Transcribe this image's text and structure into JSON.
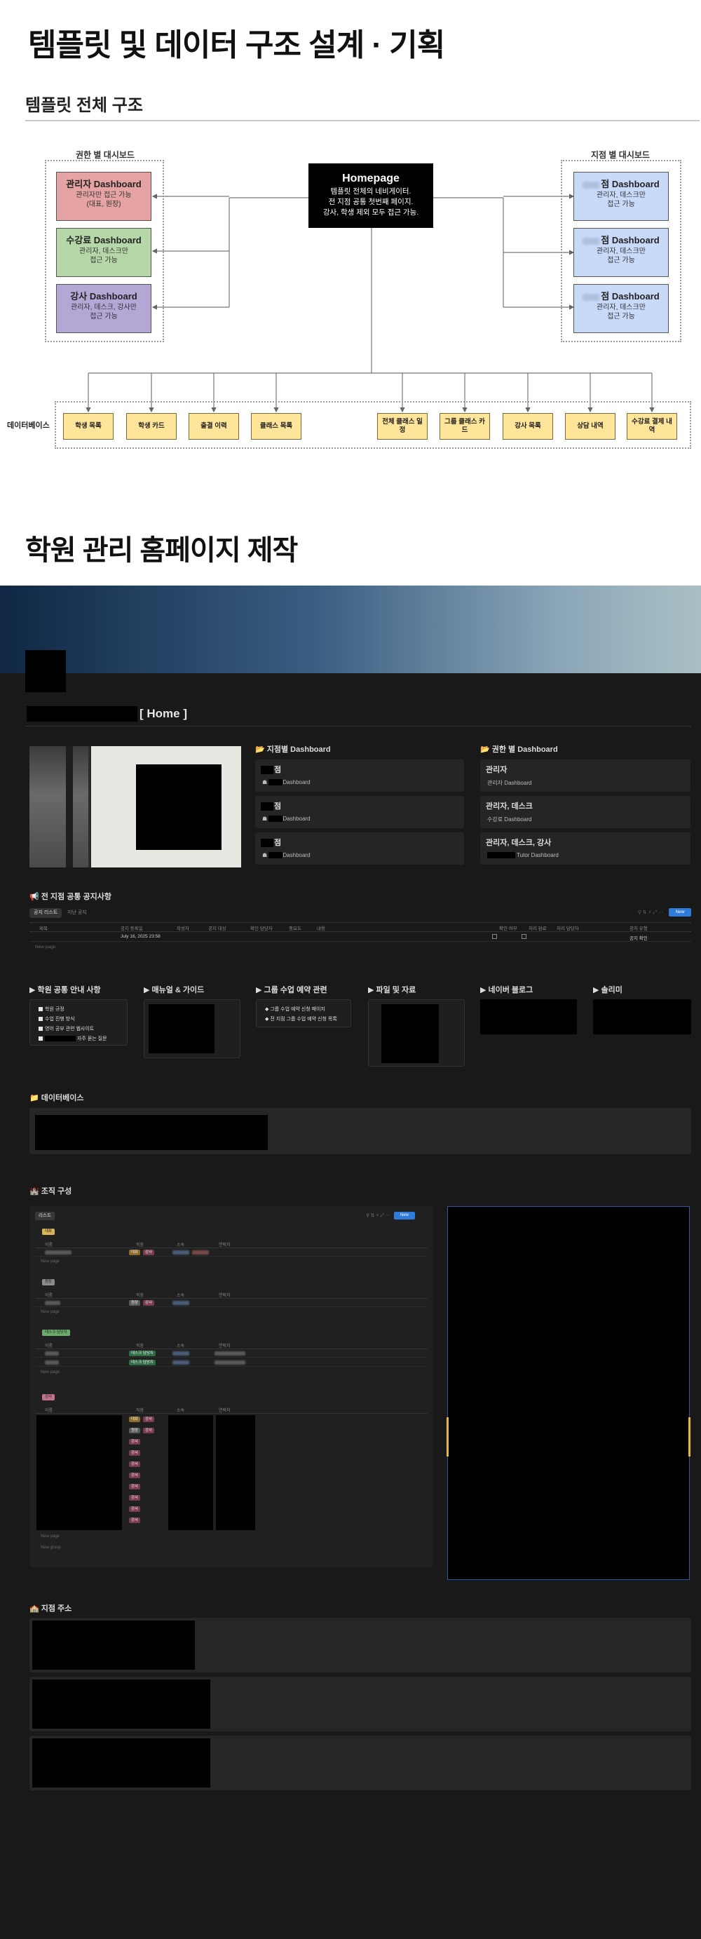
{
  "main_title": "템플릿 및 데이터 구조 설계 · 기획",
  "structure_section_title": "템플릿 전체 구조",
  "diagram": {
    "left_group_label": "권한 별 대시보드",
    "right_group_label": "지점 별 대시보드",
    "homepage": {
      "title": "Homepage",
      "line1": "템플릿 전체의 네비게이터.",
      "line2": "전 지점 공통 첫번째 페이지.",
      "line3": "강사, 학생 제외 모두 접근 가능."
    },
    "role_dashboards": [
      {
        "title": "관리자 Dashboard",
        "line1": "관리자만 접근 가능",
        "line2": "(대표, 원장)"
      },
      {
        "title": "수강료 Dashboard",
        "line1": "관리자, 데스크만",
        "line2": "접근 가능"
      },
      {
        "title": "강사 Dashboard",
        "line1": "관리자, 데스크, 강사만",
        "line2": "접근 가능"
      }
    ],
    "branch_dashboards": [
      {
        "title": "점 Dashboard",
        "line1": "관리자, 데스크만",
        "line2": "접근 가능"
      },
      {
        "title": "점 Dashboard",
        "line1": "관리자, 데스크만",
        "line2": "접근 가능"
      },
      {
        "title": "점 Dashboard",
        "line1": "관리자, 데스크만",
        "line2": "접근 가능"
      }
    ],
    "database_label": "데이터베이스",
    "databases": [
      "학생 목록",
      "학생 카드",
      "출결 이력",
      "클래스 목록",
      "전체 클래스 일정",
      "그룹 클래스 카드",
      "강사 목록",
      "상담 내역",
      "수강료 결제 내역"
    ]
  },
  "homepage_section_title": "학원 관리 홈페이지 제작",
  "notion": {
    "page_title_suffix": "[ Home ]",
    "branch_col_title": "📂 지점별 Dashboard",
    "role_col_title": "📂 권한 별 Dashboard",
    "branch_cards": [
      {
        "name": "점",
        "sub": "Dashboard"
      },
      {
        "name": "점",
        "sub": "Dashboard"
      },
      {
        "name": "점",
        "sub": "Dashboard"
      }
    ],
    "role_cards": [
      {
        "name": "관리자",
        "sub": "관리자 Dashboard"
      },
      {
        "name": "관리자, 데스크",
        "sub": "수강료 Dashboard"
      },
      {
        "name": "관리자, 데스크, 강사",
        "sub": "Tutor Dashboard"
      }
    ],
    "notice_title": "📢 전 지점 공통 공지사항",
    "notice_tab": "공지 리스트",
    "notice_tab2": "지난 공지",
    "notice_new": "New",
    "notice_columns": [
      "제목",
      "공지 등록일",
      "작성자",
      "공지 대상",
      "확인 담당자",
      "중요도",
      "내용",
      "확인 여부",
      "처리 완료",
      "처리 담당자",
      "공지 유형"
    ],
    "notice_row": {
      "date": "July 16, 2025 23:58",
      "type": "공지 확인"
    },
    "new_page": "New page",
    "toggles": [
      {
        "title": "학원 공통 안내 사항",
        "items": [
          "학원 규정",
          "수업 진행 방식",
          "영어 공부 관련 웹사이트",
          "자주 묻는 질문"
        ]
      },
      {
        "title": "매뉴얼 & 가이드",
        "items": []
      },
      {
        "title": "그룹 수업 예약 관련",
        "items": [
          "그룹 수업 예약 신청 페이지",
          "전 지점 그룹 수업 예약 신청 목록"
        ]
      },
      {
        "title": "파일 및 자료",
        "items": []
      },
      {
        "title": "네이버 블로그",
        "items": []
      },
      {
        "title": "솔리미",
        "items": []
      }
    ],
    "database_section_title": "📁 데이터베이스",
    "org_section_title": "🏰 조직 구성",
    "org": {
      "tab": "리스트",
      "new": "New",
      "columns": [
        "이름",
        "직함",
        "소속",
        "연락처"
      ],
      "groups": [
        {
          "tag": "대표"
        },
        {
          "tag": "원장"
        },
        {
          "tag": "데스크 담당자"
        },
        {
          "tag": "강사"
        }
      ],
      "chip_labels": {
        "ceo": "대표",
        "director": "원장",
        "tutor": "강사",
        "desk": "데스크 담당자"
      },
      "new_group": "New group"
    },
    "address_section_title": "🏫 지점 주소"
  },
  "colors": {
    "red": "#e5a3a3",
    "green": "#b6d7a8",
    "purple": "#b4a7d6",
    "blue": "#c9daf8",
    "yellow": "#ffe599",
    "notion_bg": "#191919",
    "accent_blue": "#2f7bdb"
  }
}
